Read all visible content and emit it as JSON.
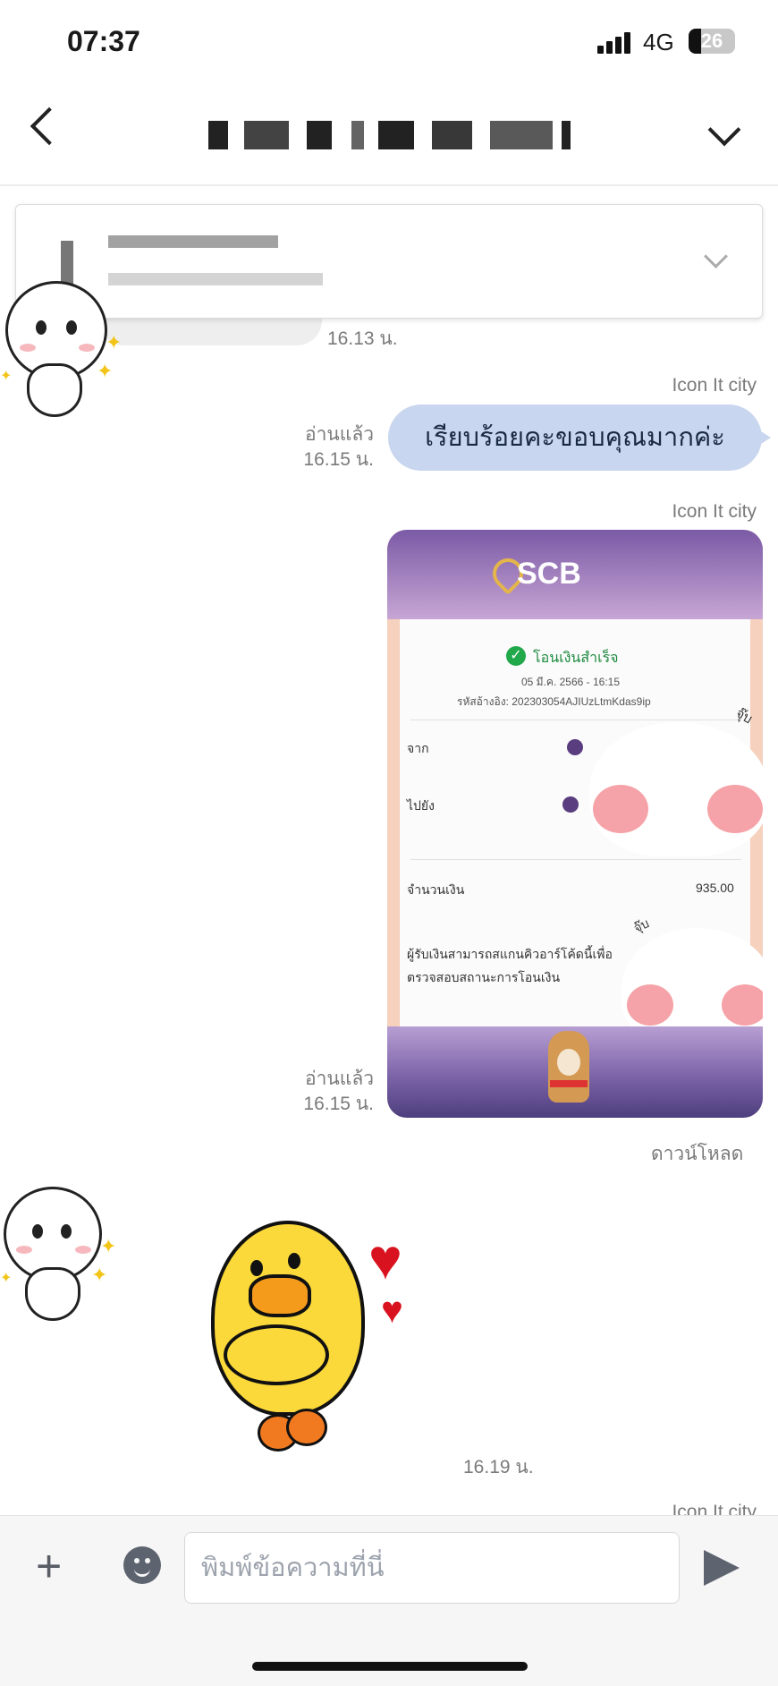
{
  "status_bar": {
    "time": "07:37",
    "network": "4G",
    "battery": "26"
  },
  "header": {
    "back": "back",
    "expand": "chevron-down"
  },
  "pinned": {
    "expand": "chevron-down"
  },
  "messages": {
    "m1_time": "16.13 น.",
    "m2_sender": "Icon It city",
    "m2_text": "เรียบร้อยคะขอบคุณมากค่ะ",
    "m2_read": "อ่านแล้ว",
    "m2_time": "16.15 น.",
    "m3_sender": "Icon It city",
    "m3_read": "อ่านแล้ว",
    "m3_time": "16.15 น.",
    "download": "ดาวน์โหลด",
    "m5_time": "16.19 น.",
    "m6_sender": "Icon It city"
  },
  "receipt": {
    "bank": "SCB",
    "status": "โอนเงินสำเร็จ",
    "date": "05 มี.ค. 2566 - 16:15",
    "ref": "รหัสอ้างอิง: 202303054AJIUzLtmKdas9ip",
    "from_label": "จาก",
    "to_label": "ไปยัง",
    "amount_label": "จำนวนเงิน",
    "amount": "935.00",
    "note_line1": "ผู้รับเงินสามารถสแกนคิวอาร์โค้ดนี้เพื่อ",
    "note_line2": "ตรวจสอบสถานะการโอนเงิน",
    "sticker_text": "จุ๊บ"
  },
  "composer": {
    "placeholder": "พิมพ์ข้อความที่นี่"
  },
  "icons": [
    "back-icon",
    "chevron-down-icon",
    "plus-icon",
    "emoji-icon",
    "send-icon"
  ]
}
